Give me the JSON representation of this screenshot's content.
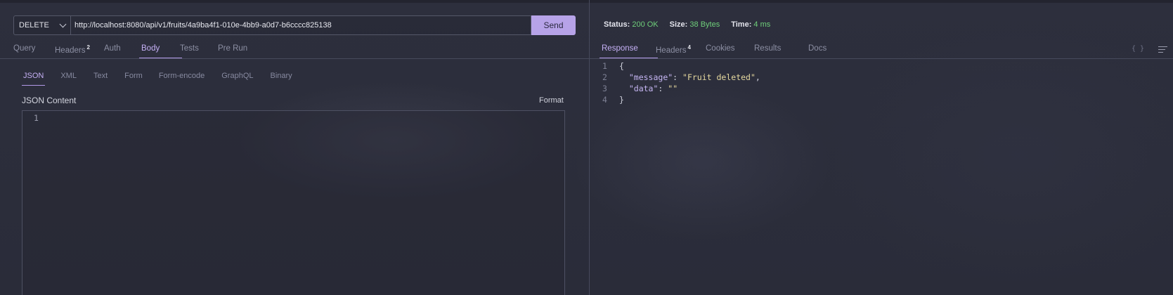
{
  "request": {
    "method": "DELETE",
    "url": "http://localhost:8080/api/v1/fruits/4a9ba4f1-010e-4bb9-a0d7-b6cccc825138",
    "send_label": "Send",
    "tabs": [
      "Query",
      "Headers",
      "Auth",
      "Body",
      "Tests",
      "Pre Run"
    ],
    "headers_count": "2",
    "active_tab": "Body",
    "body_tabs": [
      "JSON",
      "XML",
      "Text",
      "Form",
      "Form-encode",
      "GraphQL",
      "Binary"
    ],
    "active_body_tab": "JSON",
    "json_content_label": "JSON Content",
    "format_label": "Format",
    "editor_line_numbers": [
      "1"
    ]
  },
  "response": {
    "status_label": "Status:",
    "status_value": "200 OK",
    "size_label": "Size:",
    "size_value": "38 Bytes",
    "time_label": "Time:",
    "time_value": "4 ms",
    "tabs": [
      "Response",
      "Headers",
      "Cookies",
      "Results",
      "Docs"
    ],
    "headers_count": "4",
    "active_tab": "Response",
    "body_lines": [
      {
        "n": "1",
        "text": "{"
      },
      {
        "n": "2",
        "key": "\"message\"",
        "value": "\"Fruit deleted\"",
        "trail": ","
      },
      {
        "n": "3",
        "key": "\"data\"",
        "value": "\"\"",
        "trail": ""
      },
      {
        "n": "4",
        "text": "}"
      }
    ],
    "icons": [
      "braces-icon",
      "wrap-lines-icon"
    ]
  },
  "colors": {
    "accent": "#b7a3e8",
    "status_ok": "#6fcf7a",
    "background": "#2b2d3a"
  }
}
